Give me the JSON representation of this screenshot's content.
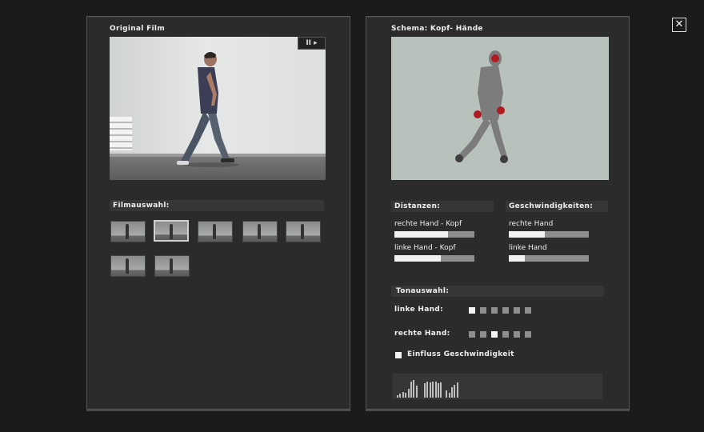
{
  "left_panel": {
    "title": "Original Film",
    "play_controls": "II ▸",
    "film_selection_label": "Filmauswahl:",
    "thumbnails": [
      {
        "selected": false
      },
      {
        "selected": true
      },
      {
        "selected": false
      },
      {
        "selected": false
      },
      {
        "selected": false
      },
      {
        "selected": false
      },
      {
        "selected": false
      }
    ]
  },
  "right_panel": {
    "title": "Schema: Kopf- Hände",
    "distances": {
      "header": "Distanzen:",
      "items": [
        {
          "label": "rechte Hand - Kopf",
          "level": 0.67
        },
        {
          "label": "linke Hand - Kopf",
          "level": 0.58
        }
      ]
    },
    "speeds": {
      "header": "Geschwindigkeiten:",
      "items": [
        {
          "label": "rechte Hand",
          "level": 0.45
        },
        {
          "label": "linke Hand",
          "level": 0.2
        }
      ]
    },
    "sound_selection": {
      "header": "Tonauswahl:",
      "left_hand_label": "linke Hand:",
      "right_hand_label": "rechte Hand:",
      "left_hand_selected_index": 0,
      "right_hand_selected_index": 2,
      "option_count": 6,
      "influence_label": "Einfluss Geschwindigkeit"
    },
    "marker_color": "#b01b22"
  },
  "close_icon": "close-icon"
}
